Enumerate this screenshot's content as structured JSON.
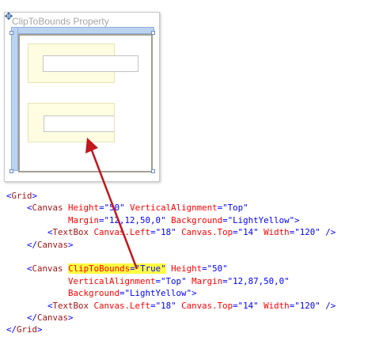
{
  "designer": {
    "title": "ClipToBounds Property"
  },
  "code": {
    "lines": [
      {
        "indent": "",
        "parts": [
          [
            "b",
            "<"
          ],
          [
            "t",
            "Grid"
          ],
          [
            "b",
            ">"
          ]
        ]
      },
      {
        "indent": "    ",
        "parts": [
          [
            "b",
            "<"
          ],
          [
            "t",
            "Canvas"
          ],
          [
            "a",
            " Height"
          ],
          [
            "b",
            "=\""
          ],
          [
            "b",
            "50"
          ],
          [
            "b",
            "\""
          ],
          [
            "a",
            " VerticalAlignment"
          ],
          [
            "b",
            "=\""
          ],
          [
            "b",
            "Top"
          ],
          [
            "b",
            "\""
          ]
        ]
      },
      {
        "indent": "            ",
        "parts": [
          [
            "a",
            "Margin"
          ],
          [
            "b",
            "=\""
          ],
          [
            "b",
            "12,12,50,0"
          ],
          [
            "b",
            "\""
          ],
          [
            "a",
            " Background"
          ],
          [
            "b",
            "=\""
          ],
          [
            "b",
            "LightYellow"
          ],
          [
            "b",
            "\">"
          ]
        ]
      },
      {
        "indent": "        ",
        "parts": [
          [
            "b",
            "<"
          ],
          [
            "t",
            "TextBox"
          ],
          [
            "a",
            " Canvas.Left"
          ],
          [
            "b",
            "=\""
          ],
          [
            "b",
            "18"
          ],
          [
            "b",
            "\""
          ],
          [
            "a",
            " Canvas.Top"
          ],
          [
            "b",
            "=\""
          ],
          [
            "b",
            "14"
          ],
          [
            "b",
            "\""
          ],
          [
            "a",
            " Width"
          ],
          [
            "b",
            "=\""
          ],
          [
            "b",
            "120"
          ],
          [
            "b",
            "\" />"
          ]
        ]
      },
      {
        "indent": "    ",
        "parts": [
          [
            "b",
            "</"
          ],
          [
            "t",
            "Canvas"
          ],
          [
            "b",
            ">"
          ]
        ]
      },
      {
        "indent": "",
        "parts": []
      },
      {
        "indent": "    ",
        "parts": [
          [
            "b",
            "<"
          ],
          [
            "t",
            "Canvas"
          ],
          [
            "b",
            " "
          ],
          [
            "ahl",
            "ClipToBounds"
          ],
          [
            "bhl",
            "=\""
          ],
          [
            "bhl",
            "True"
          ],
          [
            "bhl",
            "\""
          ],
          [
            "a",
            " Height"
          ],
          [
            "b",
            "=\""
          ],
          [
            "b",
            "50"
          ],
          [
            "b",
            "\""
          ]
        ]
      },
      {
        "indent": "            ",
        "parts": [
          [
            "a",
            "VerticalAlignment"
          ],
          [
            "b",
            "=\""
          ],
          [
            "b",
            "Top"
          ],
          [
            "b",
            "\""
          ],
          [
            "a",
            " Margin"
          ],
          [
            "b",
            "=\""
          ],
          [
            "b",
            "12,87,50,0"
          ],
          [
            "b",
            "\""
          ]
        ]
      },
      {
        "indent": "            ",
        "parts": [
          [
            "a",
            "Background"
          ],
          [
            "b",
            "=\""
          ],
          [
            "b",
            "LightYellow"
          ],
          [
            "b",
            "\">"
          ]
        ]
      },
      {
        "indent": "        ",
        "parts": [
          [
            "b",
            "<"
          ],
          [
            "t",
            "TextBox"
          ],
          [
            "a",
            " Canvas.Left"
          ],
          [
            "b",
            "=\""
          ],
          [
            "b",
            "18"
          ],
          [
            "b",
            "\""
          ],
          [
            "a",
            " Canvas.Top"
          ],
          [
            "b",
            "=\""
          ],
          [
            "b",
            "14"
          ],
          [
            "b",
            "\""
          ],
          [
            "a",
            " Width"
          ],
          [
            "b",
            "=\""
          ],
          [
            "b",
            "120"
          ],
          [
            "b",
            "\" />"
          ]
        ]
      },
      {
        "indent": "    ",
        "parts": [
          [
            "b",
            "</"
          ],
          [
            "t",
            "Canvas"
          ],
          [
            "b",
            ">"
          ]
        ]
      },
      {
        "indent": "",
        "parts": [
          [
            "b",
            "</"
          ],
          [
            "t",
            "Grid"
          ],
          [
            "b",
            ">"
          ]
        ]
      }
    ]
  },
  "colors": {
    "canvas_background": "#fffde1",
    "highlight": "#ffff44",
    "arrow": "#c0181e",
    "tag": "#a31515",
    "attribute": "#ff0000",
    "value": "#0000ff"
  },
  "icons": {
    "move_handle": "move-arrows-icon",
    "arrow": "red-arrow-icon"
  }
}
